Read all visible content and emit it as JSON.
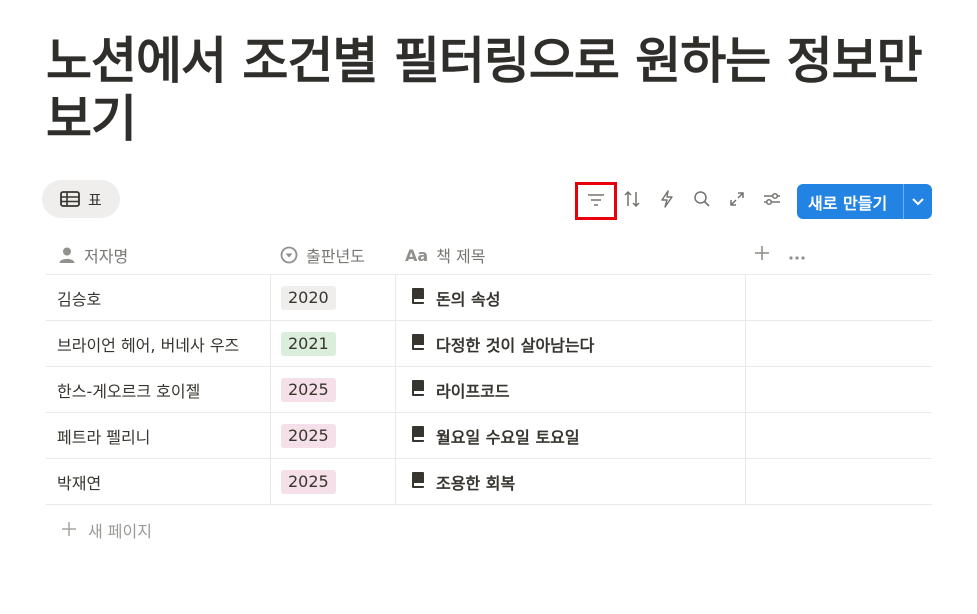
{
  "page": {
    "title": "노션에서 조건별 필터링으로 원하는 정보만 보기"
  },
  "view_tab": {
    "label": "표",
    "icon": "table-icon"
  },
  "toolbar": {
    "filter_icon": "filter-icon",
    "sort_icon": "sort-icon",
    "automation_icon": "lightning-icon",
    "search_icon": "search-icon",
    "expand_icon": "expand-icon",
    "settings_icon": "sliders-icon",
    "new_button_label": "새로 만들기",
    "highlight_color": "#e8000b",
    "accent": "#2383e2"
  },
  "table": {
    "columns": [
      {
        "label": "저자명",
        "icon": "person-icon"
      },
      {
        "label": "출판년도",
        "icon": "select-icon"
      },
      {
        "label": "책 제목",
        "icon": "text-type-icon",
        "icon_text": "Aa"
      }
    ],
    "rows": [
      {
        "author": "김승호",
        "year": "2020",
        "year_bg": "#efeeec",
        "title": "돈의 속성"
      },
      {
        "author": "브라이언 헤어, 버네사 우즈",
        "year": "2021",
        "year_bg": "#dbeddb",
        "title": "다정한 것이 살아남는다"
      },
      {
        "author": "한스-게오르크 호이젤",
        "year": "2025",
        "year_bg": "#f5e0e9",
        "title": "라이프코드"
      },
      {
        "author": "페트라 펠리니",
        "year": "2025",
        "year_bg": "#f5e0e9",
        "title": "월요일 수요일 토요일"
      },
      {
        "author": "박재연",
        "year": "2025",
        "year_bg": "#f5e0e9",
        "title": "조용한 회복"
      }
    ],
    "new_page_label": "새 페이지"
  }
}
